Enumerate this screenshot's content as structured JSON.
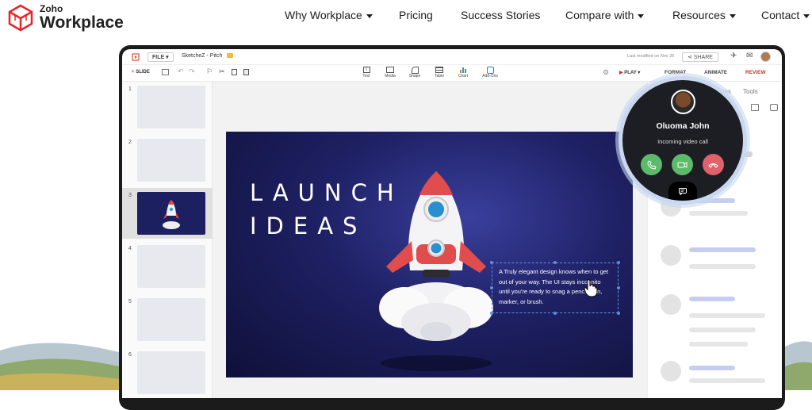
{
  "nav": {
    "logo_top": "Zoho",
    "logo_main": "Workplace",
    "links": [
      {
        "label": "Why Workplace",
        "dropdown": true
      },
      {
        "label": "Pricing",
        "dropdown": false
      },
      {
        "label": "Success Stories",
        "dropdown": false
      },
      {
        "label": "Compare with",
        "dropdown": true
      },
      {
        "label": "Resources",
        "dropdown": true
      },
      {
        "label": "Contact",
        "dropdown": true
      }
    ]
  },
  "app": {
    "file_label": "FILE",
    "doc_title": "SketcheZ - Pitch",
    "last_modified": "Last modified on Nov 26",
    "share_label": "SHARE",
    "slide_btn": "SLIDE",
    "tools": [
      "Text",
      "Media",
      "Shape",
      "Table",
      "Chart",
      "Add-Ons"
    ],
    "play_label": "PLAY",
    "tabs": [
      "FORMAT",
      "ANIMATE",
      "REVIEW"
    ],
    "panel_partial": [
      "tions",
      "Tools"
    ],
    "slide_numbers": [
      "1",
      "2",
      "3",
      "4",
      "5",
      "6"
    ],
    "active_slide": 3
  },
  "slide": {
    "title_line1": "LAUNCH",
    "title_line2": "IDEAS",
    "body": "A Truly elegant design knows when to get out of your way. The UI stays incognito until you're ready  to snag a pencil, pen, marker, or brush."
  },
  "call": {
    "name": "Oluoma John",
    "status": "Incoming video call"
  },
  "colors": {
    "accent_red": "#c0392b",
    "call_bg": "#1d1e24",
    "accept_green": "#5dba6b",
    "decline_red": "#e0626a",
    "skeleton_blue": "#c7cdf0"
  }
}
